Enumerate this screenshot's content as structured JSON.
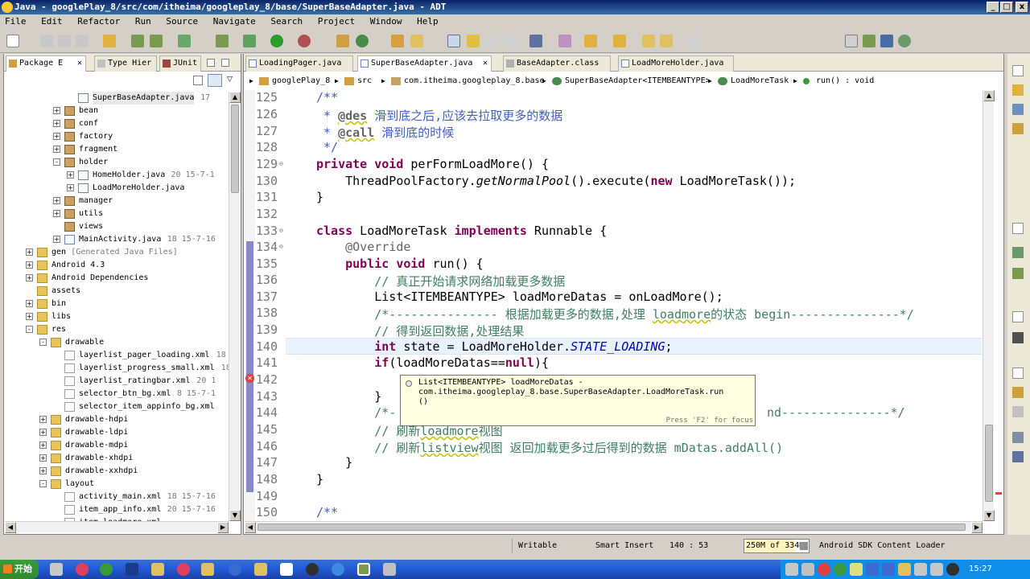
{
  "window": {
    "title": "Java - googlePlay_8/src/com/itheima/googleplay_8/base/SuperBaseAdapter.java - ADT",
    "min": "_",
    "max": "□",
    "close": "x"
  },
  "menu": [
    "File",
    "Edit",
    "Refactor",
    "Run",
    "Source",
    "Navigate",
    "Search",
    "Project",
    "Window",
    "Help"
  ],
  "left_tabs": {
    "package": "Package E",
    "type": "Type Hier",
    "junit": "JUnit"
  },
  "tree": [
    {
      "depth": 5,
      "tog": "",
      "icon": "java",
      "label": "SuperBaseAdapter.java",
      "deco": "17",
      "selected": true
    },
    {
      "depth": 4,
      "tog": "+",
      "icon": "pkg",
      "label": "bean",
      "deco": ""
    },
    {
      "depth": 4,
      "tog": "+",
      "icon": "pkg",
      "label": "conf",
      "deco": ""
    },
    {
      "depth": 4,
      "tog": "+",
      "icon": "pkg",
      "label": "factory",
      "deco": ""
    },
    {
      "depth": 4,
      "tog": "+",
      "icon": "pkg",
      "label": "fragment",
      "deco": ""
    },
    {
      "depth": 4,
      "tog": "-",
      "icon": "pkg",
      "label": "holder",
      "deco": ""
    },
    {
      "depth": 5,
      "tog": "+",
      "icon": "java",
      "label": "HomeHolder.java",
      "deco": "20  15-7-1"
    },
    {
      "depth": 5,
      "tog": "+",
      "icon": "java",
      "label": "LoadMoreHolder.java",
      "deco": ""
    },
    {
      "depth": 4,
      "tog": "+",
      "icon": "pkg",
      "label": "manager",
      "deco": ""
    },
    {
      "depth": 4,
      "tog": "+",
      "icon": "pkg",
      "label": "utils",
      "deco": ""
    },
    {
      "depth": 4,
      "tog": "",
      "icon": "pkg",
      "label": "views",
      "deco": ""
    },
    {
      "depth": 4,
      "tog": "+",
      "icon": "java",
      "label": "MainActivity.java",
      "deco": "18  15-7-16"
    },
    {
      "depth": 2,
      "tog": "+",
      "icon": "folder",
      "label": "gen",
      "deco": "[Generated Java Files]"
    },
    {
      "depth": 2,
      "tog": "+",
      "icon": "folder",
      "label": "Android 4.3",
      "deco": ""
    },
    {
      "depth": 2,
      "tog": "+",
      "icon": "folder",
      "label": "Android Dependencies",
      "deco": ""
    },
    {
      "depth": 2,
      "tog": "",
      "icon": "folder",
      "label": "assets",
      "deco": ""
    },
    {
      "depth": 2,
      "tog": "+",
      "icon": "folder",
      "label": "bin",
      "deco": ""
    },
    {
      "depth": 2,
      "tog": "+",
      "icon": "folder",
      "label": "libs",
      "deco": ""
    },
    {
      "depth": 2,
      "tog": "-",
      "icon": "folder",
      "label": "res",
      "deco": ""
    },
    {
      "depth": 3,
      "tog": "-",
      "icon": "folder",
      "label": "drawable",
      "deco": ""
    },
    {
      "depth": 4,
      "tog": "",
      "icon": "xml",
      "label": "layerlist_pager_loading.xml",
      "deco": "18"
    },
    {
      "depth": 4,
      "tog": "",
      "icon": "xml",
      "label": "layerlist_progress_small.xml",
      "deco": "18"
    },
    {
      "depth": 4,
      "tog": "",
      "icon": "xml",
      "label": "layerlist_ratingbar.xml",
      "deco": "20  1"
    },
    {
      "depth": 4,
      "tog": "",
      "icon": "xml",
      "label": "selector_btn_bg.xml",
      "deco": "8  15-7-1"
    },
    {
      "depth": 4,
      "tog": "",
      "icon": "xml",
      "label": "selector_item_appinfo_bg.xml",
      "deco": ""
    },
    {
      "depth": 3,
      "tog": "+",
      "icon": "folder",
      "label": "drawable-hdpi",
      "deco": ""
    },
    {
      "depth": 3,
      "tog": "+",
      "icon": "folder",
      "label": "drawable-ldpi",
      "deco": ""
    },
    {
      "depth": 3,
      "tog": "+",
      "icon": "folder",
      "label": "drawable-mdpi",
      "deco": ""
    },
    {
      "depth": 3,
      "tog": "+",
      "icon": "folder",
      "label": "drawable-xhdpi",
      "deco": ""
    },
    {
      "depth": 3,
      "tog": "+",
      "icon": "folder",
      "label": "drawable-xxhdpi",
      "deco": ""
    },
    {
      "depth": 3,
      "tog": "-",
      "icon": "folder",
      "label": "layout",
      "deco": ""
    },
    {
      "depth": 4,
      "tog": "",
      "icon": "xml",
      "label": "activity_main.xml",
      "deco": "18  15-7-16"
    },
    {
      "depth": 4,
      "tog": "",
      "icon": "xml",
      "label": "item_app_info.xml",
      "deco": "20  15-7-16"
    },
    {
      "depth": 4,
      "tog": "",
      "icon": "xml",
      "label": "item_loadmore.xml",
      "deco": ""
    }
  ],
  "editor_tabs": [
    {
      "label": "LoadingPager.java",
      "active": false
    },
    {
      "label": "SuperBaseAdapter.java",
      "active": true
    },
    {
      "label": "BaseAdapter.class",
      "active": false
    },
    {
      "label": "LoadMoreHolder.java",
      "active": false
    }
  ],
  "breadcrumb": [
    "googlePlay_8",
    "src",
    "com.itheima.googleplay_8.base",
    "SuperBaseAdapter<ITEMBEANTYPE>",
    "LoadMoreTask",
    "run() : void"
  ],
  "code": {
    "line_numbers": [
      "125",
      "126",
      "127",
      "128",
      "129",
      "130",
      "131",
      "132",
      "133",
      "134",
      "135",
      "136",
      "137",
      "138",
      "139",
      "140",
      "141",
      "142",
      "143",
      "144",
      "145",
      "146",
      "147",
      "148",
      "149",
      "150"
    ],
    "l125": "/**",
    "l126a": " * ",
    "l126b": "@des",
    "l126c": " 滑到底之后,应该去拉取更多的数据",
    "l127a": " * ",
    "l127b": "@call",
    "l127c": " 滑到底的时候",
    "l128": " */",
    "l129a": "private",
    "l129b": " ",
    "l129c": "void",
    "l129d": " perFormLoadMore() {",
    "l130a": "    ThreadPoolFactory.",
    "l130b": "getNormalPool",
    "l130c": "().execute(",
    "l130d": "new",
    "l130e": " LoadMoreTask());",
    "l131": "}",
    "l133a": "class",
    "l133b": " LoadMoreTask ",
    "l133c": "implements",
    "l133d": " Runnable {",
    "l134": "    @Override",
    "l135a": "    ",
    "l135b": "public",
    "l135c": " ",
    "l135d": "void",
    "l135e": " run() {",
    "l136": "        // 真正开始请求网络加载更多数据",
    "l137": "        List<ITEMBEANTYPE> loadMoreDatas = onLoadMore();",
    "l138a": "        /*--------------- 根据加载更多的数据,处理 ",
    "l138b": "loadmore",
    "l138c": "的状态 begin---------------*/",
    "l139": "        // 得到返回数据,处理结果",
    "l140a": "        ",
    "l140b": "int",
    "l140c": " state = LoadMoreHolder.",
    "l140d": "STATE_LOADING",
    "l140e": ";",
    "l141a": "        ",
    "l141b": "if",
    "l141c": "(loadMoreDatas==",
    "l141d": "null",
    "l141e": "){",
    "l143": "        }",
    "l144a": "        /*-",
    "l144b": "nd---------------*/",
    "l145a": "        // 刷新",
    "l145b": "loadmore",
    "l145c": "视图",
    "l146a": "        // 刷新",
    "l146b": "listview",
    "l146c": "视图 返回加载更多过后得到的数据 mDatas.addAll()",
    "l147": "    }",
    "l148": "}",
    "l150": "/**"
  },
  "tooltip": {
    "line1": "List<ITEMBEANTYPE> loadMoreDatas -",
    "line2": "com.itheima.googleplay_8.base.SuperBaseAdapter.LoadMoreTask.run",
    "line3": "()",
    "footer": "Press 'F2' for focus"
  },
  "status": {
    "writable": "Writable",
    "insert": "Smart Insert",
    "position": "140 : 53",
    "heap": "250M of 334M",
    "task": "Android SDK Content Loader"
  },
  "taskbar": {
    "start": "开始",
    "clock": "15:27"
  }
}
